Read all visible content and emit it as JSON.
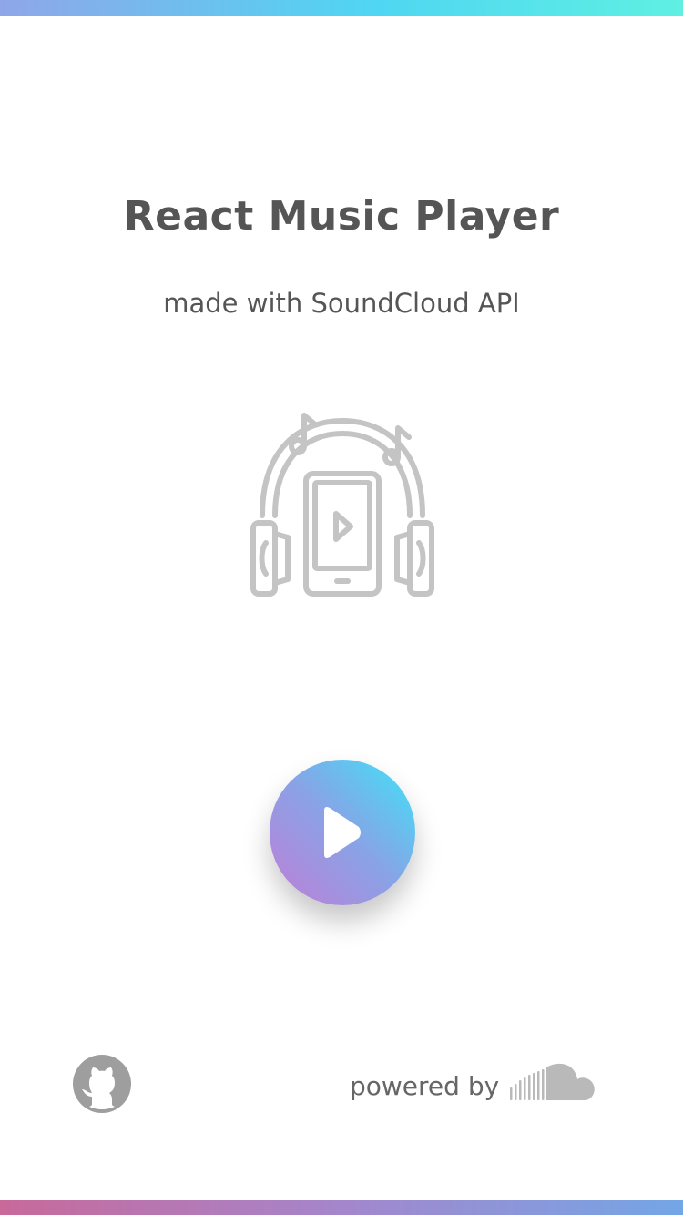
{
  "app": {
    "title": "React Music Player",
    "subtitle": "made with SoundCloud API"
  },
  "hero": {
    "illustration_icon": "headphones-phone-music-icon"
  },
  "player": {
    "play_icon": "play-icon"
  },
  "footer": {
    "github_icon": "github-icon",
    "powered_label": "powered by",
    "soundcloud_icon": "soundcloud-icon"
  },
  "colors": {
    "text": "#555555",
    "icon_gray": "#c4c4c4",
    "gradient_start": "#c07ed6",
    "gradient_end": "#3ee3f8"
  }
}
